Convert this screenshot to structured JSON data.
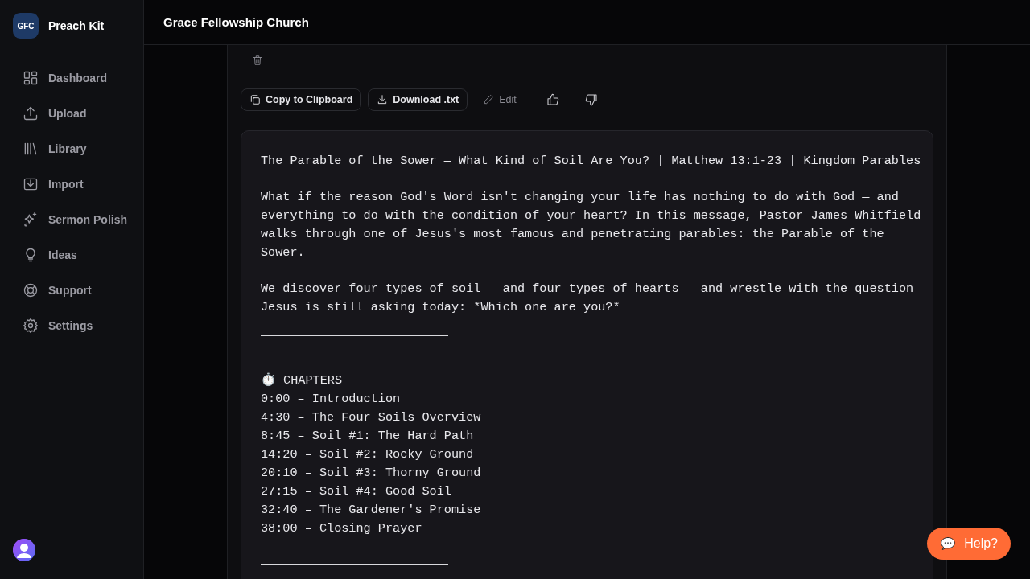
{
  "app": {
    "logo_initials": "GFC",
    "name": "Preach Kit"
  },
  "sidebar": {
    "items": [
      {
        "label": "Dashboard"
      },
      {
        "label": "Upload"
      },
      {
        "label": "Library"
      },
      {
        "label": "Import"
      },
      {
        "label": "Sermon Polish"
      },
      {
        "label": "Ideas"
      },
      {
        "label": "Support"
      },
      {
        "label": "Settings"
      }
    ]
  },
  "header": {
    "title": "Grace Fellowship Church"
  },
  "toolbar": [
    {
      "label": "Copy to Clipboard",
      "kind": "outlined"
    },
    {
      "label": "Download .txt",
      "kind": "outlined"
    },
    {
      "label": "Edit",
      "kind": "plain"
    }
  ],
  "document": {
    "title": "The Parable of the Sower — What Kind of Soil Are You? | Matthew 13:1-23 | Kingdom Parables",
    "paragraphs": [
      "What if the reason God's Word isn't changing your life has nothing to do with God — and everything to do with the condition of your heart? In this message, Pastor James Whitfield walks through one of Jesus's most famous and penetrating parables: the Parable of the Sower.",
      "We discover four types of soil — and four types of hearts — and wrestle with the question Jesus is still asking today: *Which one are you?*"
    ],
    "chapters_heading": "⏱️ CHAPTERS",
    "chapters": [
      "0:00 – Introduction",
      "4:30 – The Four Soils Overview",
      "8:45 – Soil #1: The Hard Path",
      "14:20 – Soil #2: Rocky Ground",
      "20:10 – Soil #3: Thorny Ground",
      "27:15 – Soil #4: Good Soil",
      "32:40 – The Gardener's Promise",
      "38:00 – Closing Prayer"
    ]
  },
  "help_button": {
    "label": "Help?"
  }
}
